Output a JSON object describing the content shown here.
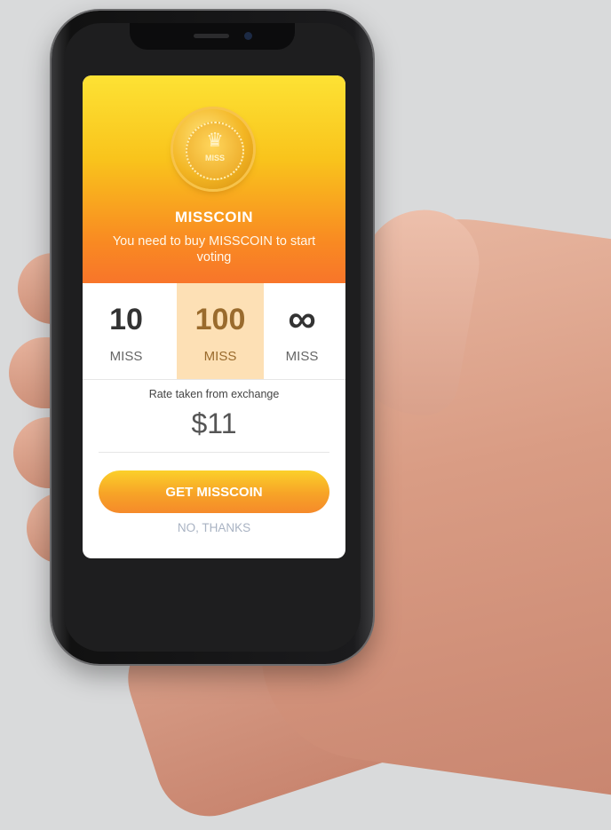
{
  "dialog": {
    "coin_label": "MISS",
    "title": "MISSCOIN",
    "subtitle": "You need to buy MISSCOIN to start voting",
    "options": [
      {
        "amount": "10",
        "unit": "MISS"
      },
      {
        "amount": "100",
        "unit": "MISS",
        "selected": true
      },
      {
        "amount": "∞",
        "unit": "MISS"
      }
    ],
    "rate_label": "Rate taken from exchange",
    "price": "$11",
    "cta_label": "GET MISSCOIN",
    "decline_label": "NO, THANKS"
  },
  "colors": {
    "header_top": "#fde234",
    "header_bottom": "#f8752a",
    "selected_option": "#fde0b5",
    "decline_text": "#a9b3c3"
  },
  "icons": [
    "misscoin-crown-icon",
    "camera-icon",
    "speaker-icon"
  ]
}
